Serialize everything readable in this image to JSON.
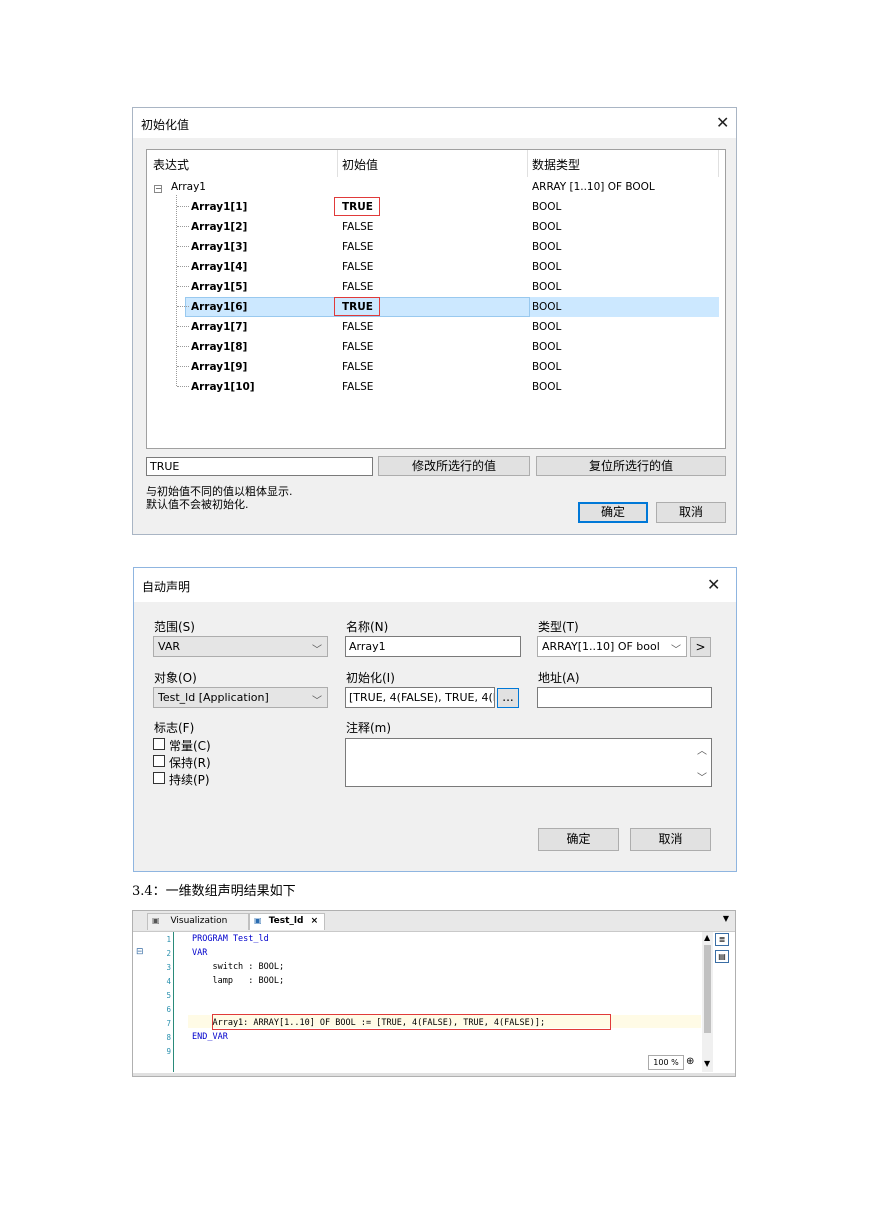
{
  "init_dialog": {
    "title": "初始化值",
    "columns": [
      "表达式",
      "初始值",
      "数据类型"
    ],
    "root": {
      "expression": "Array1",
      "type": "ARRAY [1..10] OF BOOL",
      "expander": "−"
    },
    "rows": [
      {
        "expression": "Array1[1]",
        "value": "TRUE",
        "type": "BOOL",
        "bold_value": true
      },
      {
        "expression": "Array1[2]",
        "value": "FALSE",
        "type": "BOOL"
      },
      {
        "expression": "Array1[3]",
        "value": "FALSE",
        "type": "BOOL"
      },
      {
        "expression": "Array1[4]",
        "value": "FALSE",
        "type": "BOOL"
      },
      {
        "expression": "Array1[5]",
        "value": "FALSE",
        "type": "BOOL"
      },
      {
        "expression": "Array1[6]",
        "value": "TRUE",
        "type": "BOOL",
        "bold_value": true,
        "selected": true
      },
      {
        "expression": "Array1[7]",
        "value": "FALSE",
        "type": "BOOL"
      },
      {
        "expression": "Array1[8]",
        "value": "FALSE",
        "type": "BOOL"
      },
      {
        "expression": "Array1[9]",
        "value": "FALSE",
        "type": "BOOL"
      },
      {
        "expression": "Array1[10]",
        "value": "FALSE",
        "type": "BOOL"
      }
    ],
    "edit_value": "TRUE",
    "modify_button": "修改所选行的值",
    "reset_button": "复位所选行的值",
    "note_line1": "与初始值不同的值以粗体显示.",
    "note_line2": "默认值不会被初始化.",
    "ok_button": "确定",
    "cancel_button": "取消"
  },
  "declare_dialog": {
    "title": "自动声明",
    "scope_label": "范围(S)",
    "scope_value": "VAR",
    "name_label": "名称(N)",
    "name_value": "Array1",
    "type_label": "类型(T)",
    "type_value": "ARRAY[1..10] OF bool",
    "type_button": ">",
    "object_label": "对象(O)",
    "object_value": "Test_ld [Application]",
    "init_label": "初始化(I)",
    "init_value": "[TRUE, 4(FALSE), TRUE, 4(F...",
    "init_button": "...",
    "address_label": "地址(A)",
    "address_value": "",
    "flags_label": "标志(F)",
    "flag_constant": "常量(C)",
    "flag_retain": "保持(R)",
    "flag_persistent": "持续(P)",
    "comment_label": "注释(m)",
    "comment_value": "",
    "ok_button": "确定",
    "cancel_button": "取消"
  },
  "caption": "3.4：一维数组声明结果如下",
  "editor": {
    "tabs": [
      {
        "label": "Visualization",
        "active": false
      },
      {
        "label": "Test_ld",
        "active": true
      }
    ],
    "tab_close": "×",
    "lines": [
      {
        "num": "1",
        "text": "PROGRAM Test_ld"
      },
      {
        "num": "2",
        "text": "VAR"
      },
      {
        "num": "3",
        "text": "    switch : BOOL;"
      },
      {
        "num": "4",
        "text": "    lamp   : BOOL;"
      },
      {
        "num": "5",
        "text": ""
      },
      {
        "num": "6",
        "text": ""
      },
      {
        "num": "7",
        "text": "    Array1: ARRAY[1..10] OF BOOL := [TRUE, 4(FALSE), TRUE, 4(FALSE)];"
      },
      {
        "num": "8",
        "text": "END_VAR"
      },
      {
        "num": "9",
        "text": ""
      }
    ],
    "zoom": "100 %"
  }
}
